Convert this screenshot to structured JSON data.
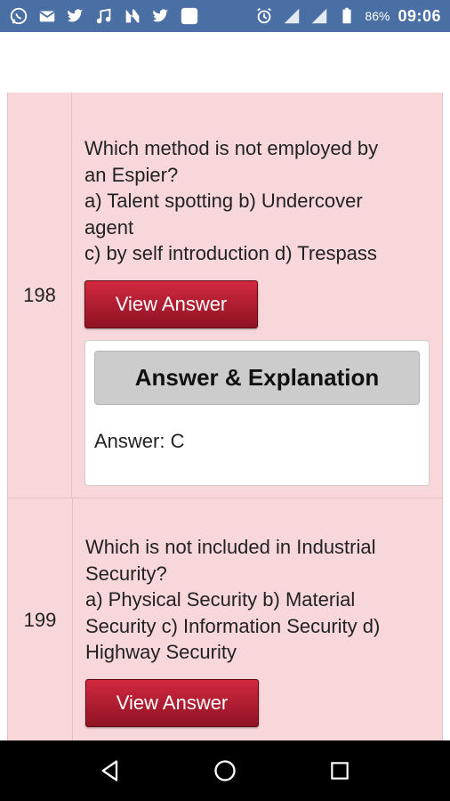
{
  "status_bar": {
    "left_icons": [
      "whatsapp-icon",
      "mail-icon",
      "twitter-icon",
      "music-icon",
      "news-icon",
      "twitter-icon",
      "app-square-icon"
    ],
    "right_icons": [
      "alarm-icon",
      "signal-icon",
      "signal-icon",
      "battery-icon"
    ],
    "battery": "86%",
    "time": "09:06"
  },
  "questions": [
    {
      "number": "198",
      "lines": [
        "Which method is not employed by",
        "an Espier?",
        "a) Talent spotting b) Undercover",
        "agent",
        "c) by self introduction d) Trespass"
      ],
      "button_label": "View Answer",
      "answer_title": "Answer & Explanation",
      "answer": "Answer: C"
    },
    {
      "number": "199",
      "lines": [
        "Which is not included in Industrial",
        "Security?",
        "a) Physical Security b) Material",
        "Security c) Information Security d)",
        "Highway Security"
      ],
      "button_label": "View Answer"
    }
  ],
  "colors": {
    "status_bar": "#4a6fa5",
    "row_bg": "#f8d7da",
    "button": "#b51e32",
    "answer_header": "#cccccc"
  }
}
